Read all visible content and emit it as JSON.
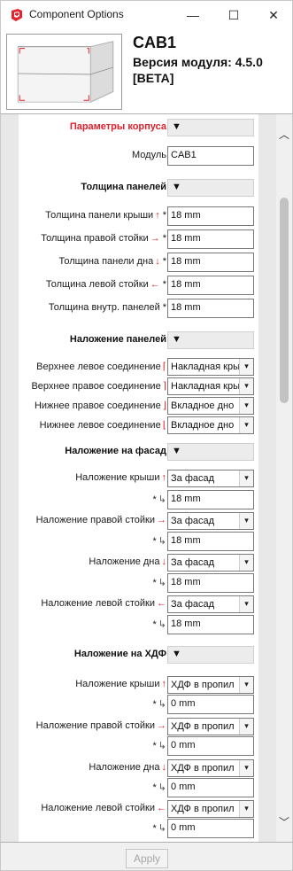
{
  "window": {
    "title": "Component Options",
    "min_glyph": "—",
    "max_glyph": "☐",
    "close_glyph": "✕"
  },
  "header": {
    "name": "CAB1",
    "version": "Версия модуля: 4.5.0",
    "beta": "[BETA]"
  },
  "toggle_glyph": "▼",
  "chevron_glyph": "▾",
  "colors": {
    "accent_red": "#e0202c"
  },
  "rows": {
    "sec_body": {
      "label": "Параметры корпуса"
    },
    "module": {
      "label": "Модуль",
      "value": "CAB1"
    },
    "sec_thickness": {
      "label": "Толщина панелей"
    },
    "t_roof": {
      "label": "Толщина панели крыши",
      "arrow": "↑",
      "star": "*",
      "value": "18 mm"
    },
    "t_right": {
      "label": "Толщина правой стойки",
      "arrow": "→",
      "star": "*",
      "value": "18 mm"
    },
    "t_bottom": {
      "label": "Толщина панели дна",
      "arrow": "↓",
      "star": "*",
      "value": "18 mm"
    },
    "t_left": {
      "label": "Толщина левой стойки",
      "arrow": "←",
      "star": "*",
      "value": "18 mm"
    },
    "t_inner": {
      "label": "Толщина внутр. панелей",
      "star": "*",
      "value": "18 mm"
    },
    "sec_overlay": {
      "label": "Наложение панелей"
    },
    "j_top_left": {
      "label": "Верхнее левое соединение",
      "mark": "⌈",
      "value": "Накладная крыша"
    },
    "j_top_right": {
      "label": "Верхнее правое соединение",
      "mark": "⌉",
      "value": "Накладная крыша"
    },
    "j_bot_right": {
      "label": "Нижнее правое соединение",
      "mark": "⌋",
      "value": "Вкладное дно"
    },
    "j_bot_left": {
      "label": "Нижнее левое соединение",
      "mark": "⌊",
      "value": "Вкладное дно"
    },
    "sec_facade": {
      "label": "Наложение на фасад"
    },
    "f_roof": {
      "label": "Наложение крыши",
      "arrow": "↑",
      "value": "За фасад"
    },
    "f_roof_val": {
      "star": "*",
      "ind": "↳",
      "value": "18 mm"
    },
    "f_right": {
      "label": "Наложение правой стойки",
      "arrow": "→",
      "value": "За фасад"
    },
    "f_right_val": {
      "star": "*",
      "ind": "↳",
      "value": "18 mm"
    },
    "f_bottom": {
      "label": "Наложение дна",
      "arrow": "↓",
      "value": "За фасад"
    },
    "f_bottom_val": {
      "star": "*",
      "ind": "↳",
      "value": "18 mm"
    },
    "f_left": {
      "label": "Наложение левой стойки",
      "arrow": "←",
      "value": "За фасад"
    },
    "f_left_val": {
      "star": "*",
      "ind": "↳",
      "value": "18 mm"
    },
    "sec_hdf": {
      "label": "Наложение на ХДФ"
    },
    "h_roof": {
      "label": "Наложение крыши",
      "arrow": "↑",
      "value": "ХДФ в пропил"
    },
    "h_roof_val": {
      "star": "*",
      "ind": "↳",
      "value": "0 mm"
    },
    "h_right": {
      "label": "Наложение правой стойки",
      "arrow": "→",
      "value": "ХДФ в пропил"
    },
    "h_right_val": {
      "star": "*",
      "ind": "↳",
      "value": "0 mm"
    },
    "h_bottom": {
      "label": "Наложение дна",
      "arrow": "↓",
      "value": "ХДФ в пропил"
    },
    "h_bottom_val": {
      "star": "*",
      "ind": "↳",
      "value": "0 mm"
    },
    "h_left": {
      "label": "Наложение левой стойки",
      "arrow": "←",
      "value": "ХДФ в пропил"
    },
    "h_left_val": {
      "star": "*",
      "ind": "↳",
      "value": "0 mm"
    }
  },
  "scrollbar": {
    "up_glyph": "︿",
    "down_glyph": "﹀"
  },
  "footer": {
    "apply_label": "Apply"
  }
}
